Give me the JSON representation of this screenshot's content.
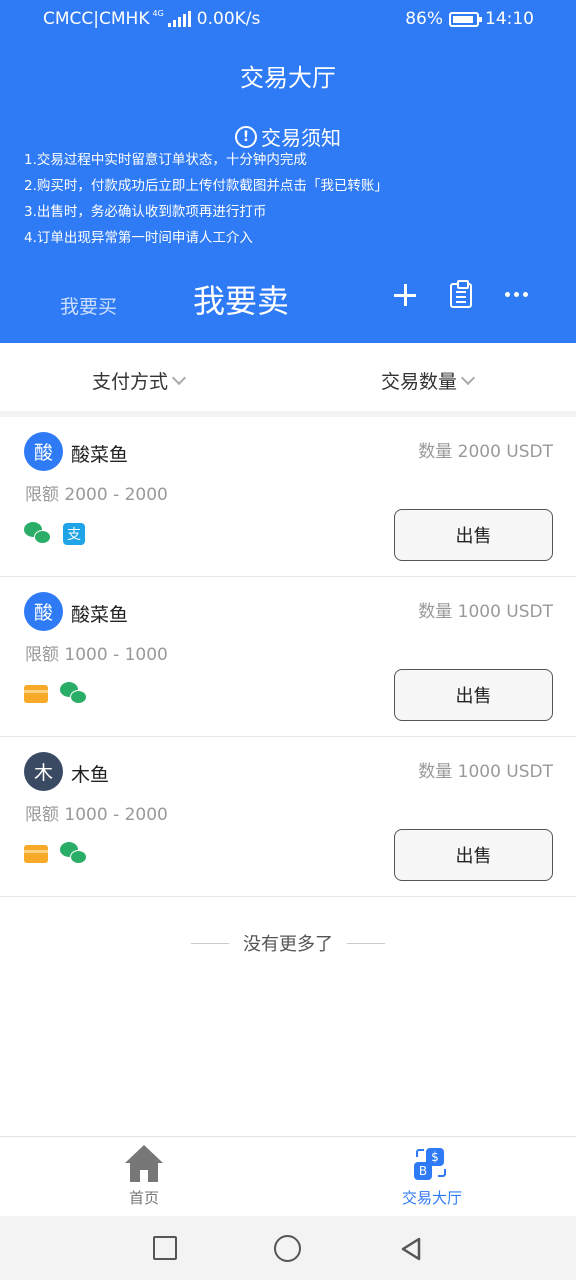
{
  "status_bar": {
    "carrier": "CMCC|CMHK",
    "network_type": "4G",
    "speed": "0.00K/s",
    "battery": "86%",
    "time": "14:10"
  },
  "header": {
    "title": "交易大厅",
    "notice_title": "交易须知",
    "notices": [
      "1.交易过程中实时留意订单状态，十分钟内完成",
      "2.购买时，付款成功后立即上传付款截图并点击「我已转账」",
      "3.出售时，务必确认收到款项再进行打币",
      "4.订单出现异常第一时间申请人工介入"
    ],
    "tab_buy": "我要买",
    "tab_sell": "我要卖",
    "active_tab": "sell"
  },
  "filters": {
    "payment_method": "支付方式",
    "trade_quantity": "交易数量"
  },
  "listings": [
    {
      "avatar_char": "酸",
      "avatar_color": "#2f7bf5",
      "seller": "酸菜鱼",
      "quantity": "数量 2000 USDT",
      "limit": "限额 2000 - 2000",
      "payment_icons": [
        "wechat-pay-icon",
        "alipay-icon"
      ],
      "button": "出售"
    },
    {
      "avatar_char": "酸",
      "avatar_color": "#2f7bf5",
      "seller": "酸菜鱼",
      "quantity": "数量 1000 USDT",
      "limit": "限额 1000 - 1000",
      "payment_icons": [
        "bank-card-icon",
        "wechat-pay-icon"
      ],
      "button": "出售"
    },
    {
      "avatar_char": "木",
      "avatar_color": "#3a4a63",
      "seller": "木鱼",
      "quantity": "数量 1000 USDT",
      "limit": "限额 1000 - 2000",
      "payment_icons": [
        "bank-card-icon",
        "wechat-pay-icon"
      ],
      "button": "出售"
    }
  ],
  "end_note": "没有更多了",
  "bottom_nav": {
    "home": "首页",
    "hall": "交易大厅",
    "active": "hall"
  },
  "colors": {
    "primary": "#2f7bf5",
    "wechat": "#2aae67",
    "alipay": "#1fa4e8",
    "bank_card": "#f7a928"
  }
}
